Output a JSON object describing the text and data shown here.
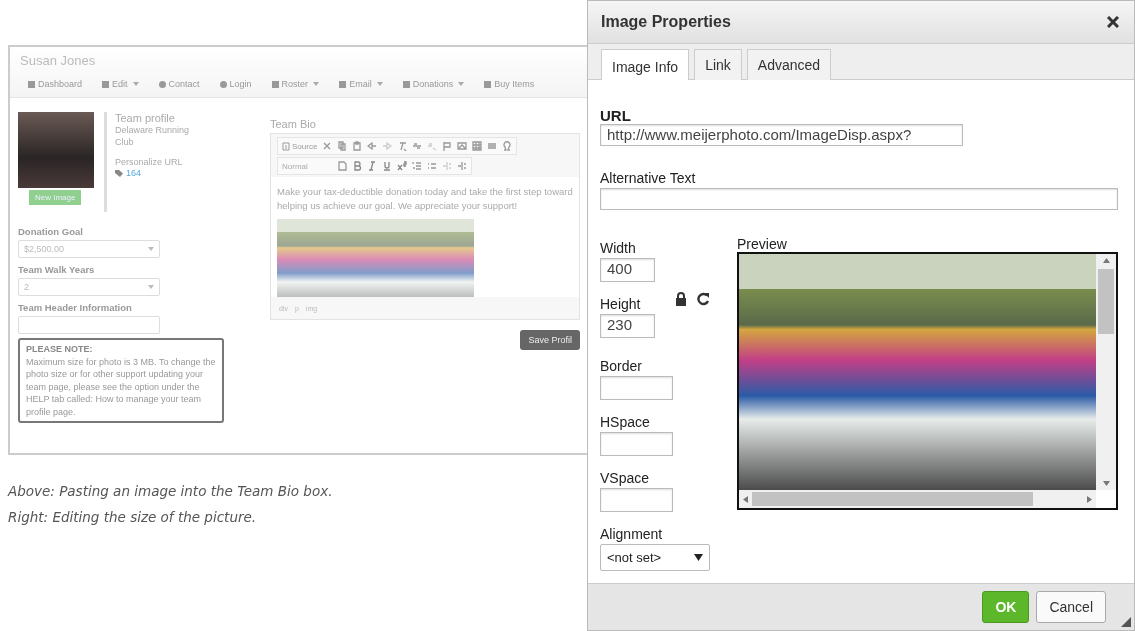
{
  "page": {
    "user_name": "Susan Jones",
    "nav": [
      {
        "label": "Dashboard",
        "dropdown": false
      },
      {
        "label": "Edit",
        "dropdown": true
      },
      {
        "label": "Contact",
        "dropdown": false
      },
      {
        "label": "Login",
        "dropdown": false
      },
      {
        "label": "Roster",
        "dropdown": true
      },
      {
        "label": "Email",
        "dropdown": true
      },
      {
        "label": "Donations",
        "dropdown": true
      },
      {
        "label": "Buy Items",
        "dropdown": false
      }
    ],
    "profile": {
      "heading": "Team profile",
      "team_name": "Delaware Running Club",
      "url_label": "Personalize URL",
      "url_value": "164",
      "new_image_button": "New Image"
    },
    "fields": [
      {
        "label": "Donation Goal",
        "value": "$2,500.00",
        "kind": "select"
      },
      {
        "label": "Team Walk Years",
        "value": "2",
        "kind": "select"
      },
      {
        "label": "Team Header Information",
        "kind": "text"
      }
    ],
    "note": {
      "title": "PLEASE NOTE:",
      "text": "Maximum size for photo is 3 MB. To change the photo size or for other support updating your team page, please see the option under the HELP tab called: How to manage your team profile page."
    },
    "bio": {
      "title": "Team Bio",
      "source_button": "Source",
      "format_select": "Normal",
      "paragraph": "Make your tax-deductible donation today and take the first step toward helping us achieve our goal. We appreciate your support!",
      "path": [
        "div",
        "p",
        "img"
      ],
      "save_button": "Save Profil"
    }
  },
  "captions": [
    "Above: Pasting an image into the Team Bio box.",
    "Right: Editing the size of the picture."
  ],
  "dialog": {
    "title": "Image Properties",
    "tabs": [
      {
        "label": "Image Info",
        "selected": true
      },
      {
        "label": "Link",
        "selected": false
      },
      {
        "label": "Advanced",
        "selected": false
      }
    ],
    "url_label": "URL",
    "url_value": "http://www.meijerphoto.com/ImageDisp.aspx?",
    "alt_label": "Alternative Text",
    "size_fields": [
      {
        "label": "Width",
        "value": "400"
      },
      {
        "label": "Height",
        "value": "230"
      }
    ],
    "other_fields": [
      {
        "label": "Border"
      },
      {
        "label": "HSpace"
      },
      {
        "label": "VSpace"
      }
    ],
    "alignment_label": "Alignment",
    "alignment_value": "<not set>",
    "preview_label": "Preview",
    "buttons": [
      {
        "label": "OK",
        "kind": "primary"
      },
      {
        "label": "Cancel",
        "kind": "secondary"
      }
    ]
  }
}
